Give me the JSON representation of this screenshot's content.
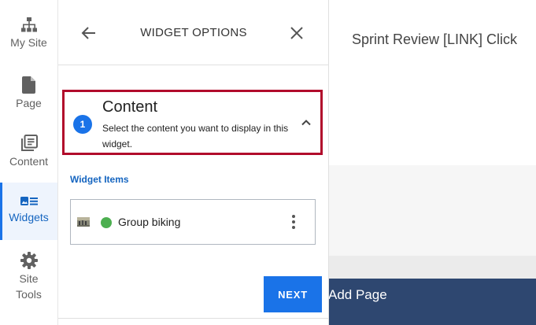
{
  "sidebar": {
    "items": [
      {
        "label": "My Site",
        "icon": "sitemap-icon"
      },
      {
        "label": "Page",
        "icon": "page-icon"
      },
      {
        "label": "Content",
        "icon": "library-icon"
      },
      {
        "label": "Widgets",
        "icon": "widgets-icon",
        "active": true
      },
      {
        "label_line1": "Site",
        "label_line2": "Tools",
        "icon": "gear-icon"
      }
    ]
  },
  "panel": {
    "title": "WIDGET OPTIONS",
    "back_icon": "arrow-left-icon",
    "close_icon": "close-icon",
    "step": {
      "number": "1",
      "title": "Content",
      "description": "Select the content you want to display in this widget.",
      "expanded": true
    },
    "section_label": "Widget Items",
    "items": [
      {
        "label": "Group biking",
        "status": "published",
        "status_color": "#4caf50"
      }
    ],
    "next_label": "NEXT"
  },
  "page": {
    "heading": "Sprint Review   [LINK] Click",
    "footer_label": "Add Page"
  },
  "colors": {
    "accent": "#1a73e8",
    "highlight_border": "#b10b2b",
    "footer": "#2e4770"
  }
}
